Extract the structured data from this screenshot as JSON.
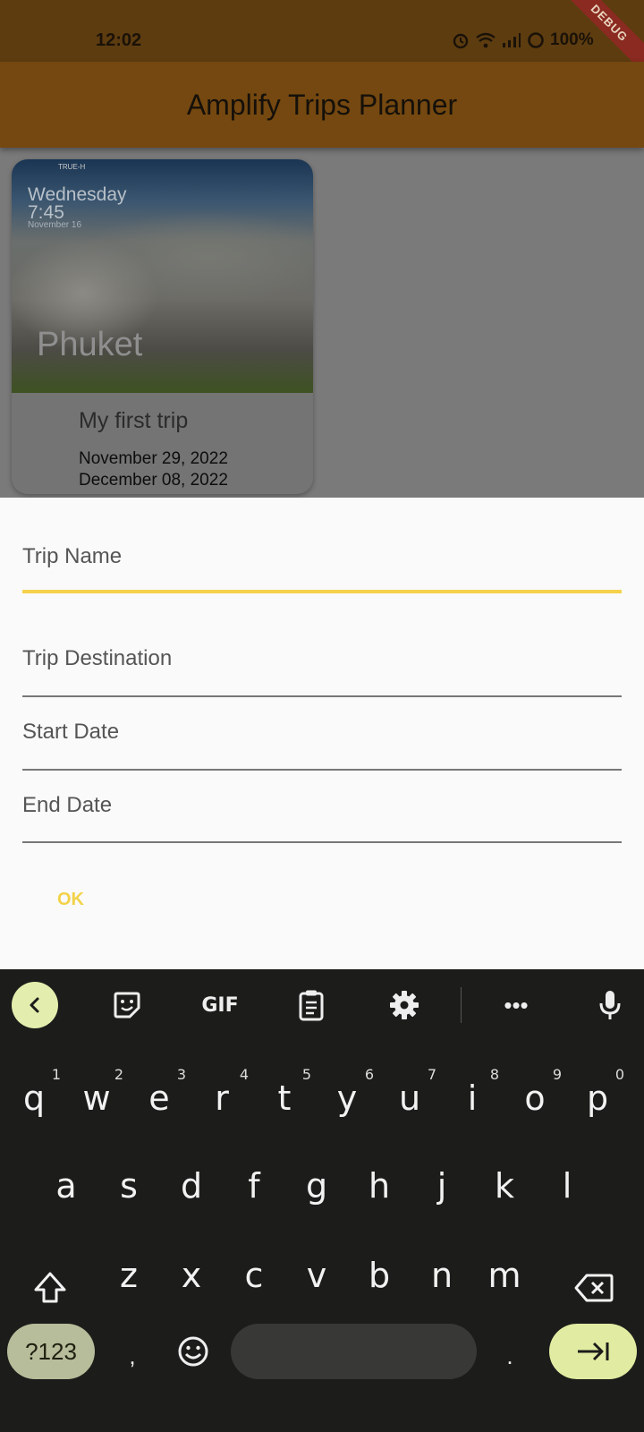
{
  "status_bar": {
    "time": "12:02",
    "battery": "100%",
    "debug_banner": "DEBUG"
  },
  "app_bar": {
    "title": "Amplify Trips Planner"
  },
  "trip_card": {
    "image_overlay": {
      "day": "Wednesday",
      "time": "7:45",
      "date": "November 16",
      "carrier": "TRUE-H"
    },
    "destination": "Phuket",
    "trip_name": "My first trip",
    "start_date": "November 29, 2022",
    "end_date": "December 08, 2022"
  },
  "form": {
    "trip_name_label": "Trip Name",
    "trip_destination_label": "Trip Destination",
    "start_date_label": "Start Date",
    "end_date_label": "End Date",
    "ok_label": "OK"
  },
  "keyboard": {
    "toolbar": {
      "gif_label": "GIF",
      "more_label": "•••"
    },
    "row1": [
      {
        "key": "q",
        "hint": "1"
      },
      {
        "key": "w",
        "hint": "2"
      },
      {
        "key": "e",
        "hint": "3"
      },
      {
        "key": "r",
        "hint": "4"
      },
      {
        "key": "t",
        "hint": "5"
      },
      {
        "key": "y",
        "hint": "6"
      },
      {
        "key": "u",
        "hint": "7"
      },
      {
        "key": "i",
        "hint": "8"
      },
      {
        "key": "o",
        "hint": "9"
      },
      {
        "key": "p",
        "hint": "0"
      }
    ],
    "row2": [
      "a",
      "s",
      "d",
      "f",
      "g",
      "h",
      "j",
      "k",
      "l"
    ],
    "row3": [
      "z",
      "x",
      "c",
      "v",
      "b",
      "n",
      "m"
    ],
    "symbols_label": "?123",
    "comma_label": ",",
    "period_label": "."
  },
  "colors": {
    "accent": "#f5d24c",
    "app_bar_dimmed": "#744810",
    "keyboard_bg": "#1c1c1a",
    "enter_key": "#e1eca2"
  }
}
